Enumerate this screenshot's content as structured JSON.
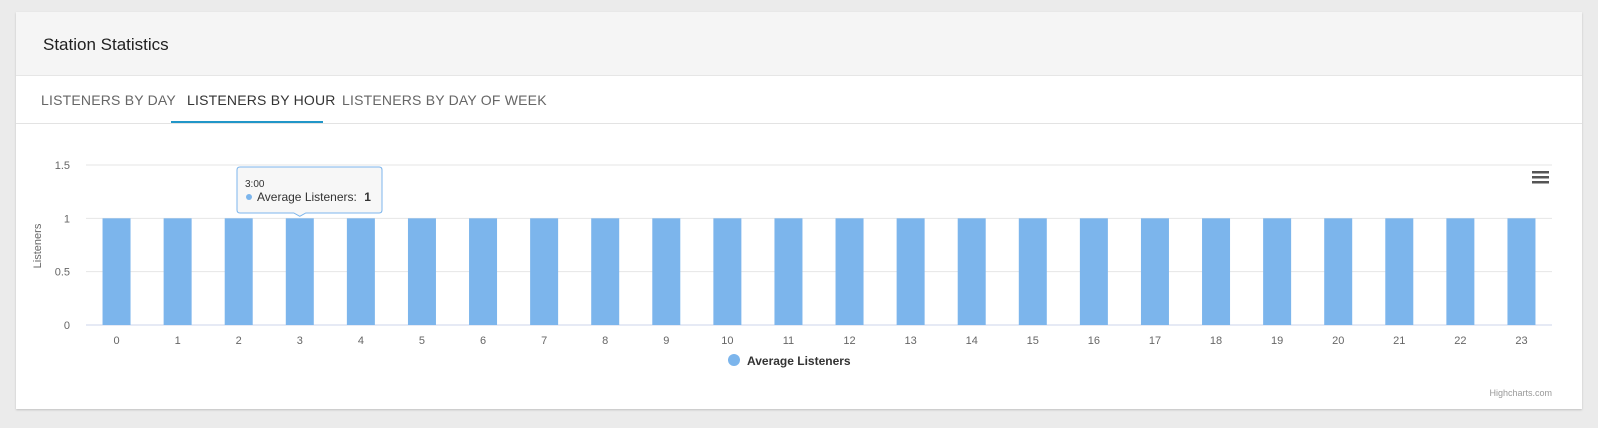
{
  "card": {
    "title": "Station Statistics"
  },
  "tabs": [
    {
      "label": "LISTENERS BY DAY",
      "active": false
    },
    {
      "label": "LISTENERS BY HOUR",
      "active": true
    },
    {
      "label": "LISTENERS BY DAY OF WEEK",
      "active": false
    }
  ],
  "chart_data": {
    "type": "bar",
    "categories": [
      "0",
      "1",
      "2",
      "3",
      "4",
      "5",
      "6",
      "7",
      "8",
      "9",
      "10",
      "11",
      "12",
      "13",
      "14",
      "15",
      "16",
      "17",
      "18",
      "19",
      "20",
      "21",
      "22",
      "23"
    ],
    "series": [
      {
        "name": "Average Listeners",
        "color": "#7cb5ec",
        "values": [
          1,
          1,
          1,
          1,
          1,
          1,
          1,
          1,
          1,
          1,
          1,
          1,
          1,
          1,
          1,
          1,
          1,
          1,
          1,
          1,
          1,
          1,
          1,
          1
        ]
      }
    ],
    "ylabel": "Listeners",
    "ylim": [
      0,
      1.5
    ],
    "yticks": [
      "0",
      "0.5",
      "1",
      "1.5"
    ],
    "grid": true,
    "legend_position": "bottom-center",
    "tooltip": {
      "title": "3:00",
      "series_label": "Average Listeners:",
      "value": "1",
      "category_index": 3
    },
    "credits": "Highcharts.com"
  },
  "menu_icon": "hamburger-menu-icon",
  "colors": {
    "accent": "#2196c8",
    "bar": "#7cb5ec"
  }
}
